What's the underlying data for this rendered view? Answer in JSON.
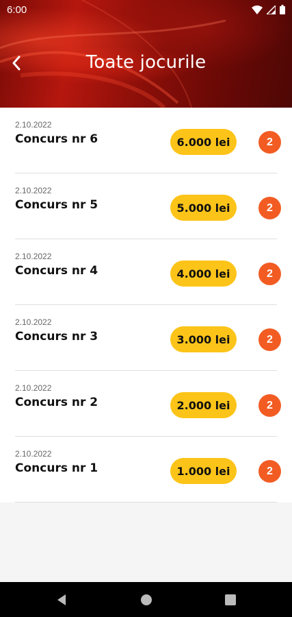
{
  "status_bar": {
    "time": "6:00"
  },
  "header": {
    "title": "Toate jocurile"
  },
  "contests": [
    {
      "date": "2.10.2022",
      "name": "Concurs nr 6",
      "prize": "6.000 lei",
      "count": "2"
    },
    {
      "date": "2.10.2022",
      "name": "Concurs nr 5",
      "prize": "5.000 lei",
      "count": "2"
    },
    {
      "date": "2.10.2022",
      "name": "Concurs nr 4",
      "prize": "4.000 lei",
      "count": "2"
    },
    {
      "date": "2.10.2022",
      "name": "Concurs nr 3",
      "prize": "3.000 lei",
      "count": "2"
    },
    {
      "date": "2.10.2022",
      "name": "Concurs nr 2",
      "prize": "2.000 lei",
      "count": "2"
    },
    {
      "date": "2.10.2022",
      "name": "Concurs nr 1",
      "prize": "1.000 lei",
      "count": "2"
    }
  ],
  "colors": {
    "prize_badge": "#fcc419",
    "count_badge": "#f25c23",
    "header": "#8c0f09"
  },
  "icons": [
    "wifi-icon",
    "signal-icon",
    "battery-icon",
    "back-arrow-icon",
    "nav-back-icon",
    "nav-home-icon",
    "nav-recents-icon"
  ]
}
